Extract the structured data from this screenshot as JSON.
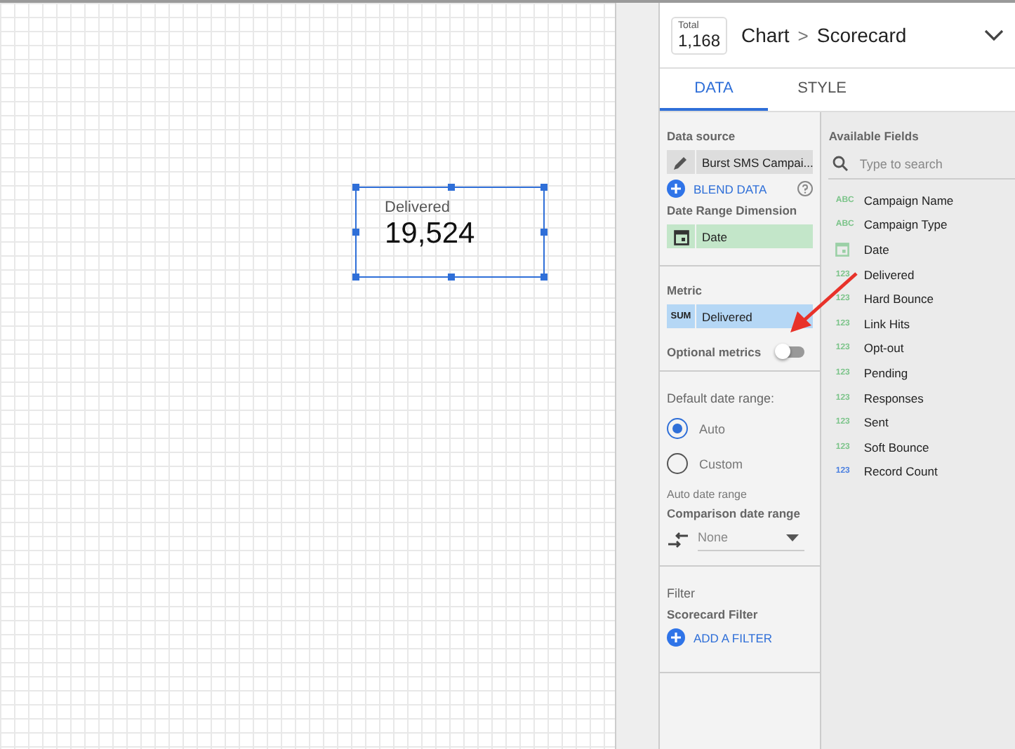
{
  "canvas": {
    "scorecard": {
      "label": "Delivered",
      "value": "19,524"
    }
  },
  "header": {
    "total_label": "Total",
    "total_value": "1,168",
    "crumb": "Chart",
    "separator": ">",
    "title": "Scorecard"
  },
  "tabs": [
    {
      "label": "DATA",
      "selected": true
    },
    {
      "label": "STYLE",
      "selected": false
    }
  ],
  "data": {
    "data_source_heading": "Data source",
    "data_source": "Burst SMS Campai...",
    "blend": "BLEND DATA",
    "date_range_heading": "Date Range Dimension",
    "date_dimension": "Date",
    "metric_heading": "Metric",
    "metric_agg": "SUM",
    "metric": "Delivered",
    "optional_metrics": "Optional metrics",
    "optional_on": false,
    "default_range_heading": "Default date range:",
    "ranges": [
      {
        "label": "Auto",
        "selected": true
      },
      {
        "label": "Custom",
        "selected": false
      }
    ],
    "auto_range": "Auto date range",
    "comparison_heading": "Comparison date range",
    "comparison": "None",
    "filter_heading": "Filter",
    "filter_sub": "Scorecard Filter",
    "add_filter": "ADD A FILTER"
  },
  "fields": {
    "heading": "Available Fields",
    "search_placeholder": "Type to search",
    "items": [
      {
        "name": "Campaign Name",
        "kind": "text",
        "type_label": "ABC"
      },
      {
        "name": "Campaign Type",
        "kind": "text",
        "type_label": "ABC"
      },
      {
        "name": "Date",
        "kind": "date"
      },
      {
        "name": "Delivered",
        "kind": "number",
        "type_label": "123"
      },
      {
        "name": "Hard Bounce",
        "kind": "number",
        "type_label": "123"
      },
      {
        "name": "Link Hits",
        "kind": "number",
        "type_label": "123"
      },
      {
        "name": "Opt-out",
        "kind": "number",
        "type_label": "123"
      },
      {
        "name": "Pending",
        "kind": "number",
        "type_label": "123"
      },
      {
        "name": "Responses",
        "kind": "number",
        "type_label": "123"
      },
      {
        "name": "Sent",
        "kind": "number",
        "type_label": "123"
      },
      {
        "name": "Soft Bounce",
        "kind": "number",
        "type_label": "123"
      },
      {
        "name": "Record Count",
        "kind": "calculated",
        "type_label": "123"
      }
    ]
  }
}
